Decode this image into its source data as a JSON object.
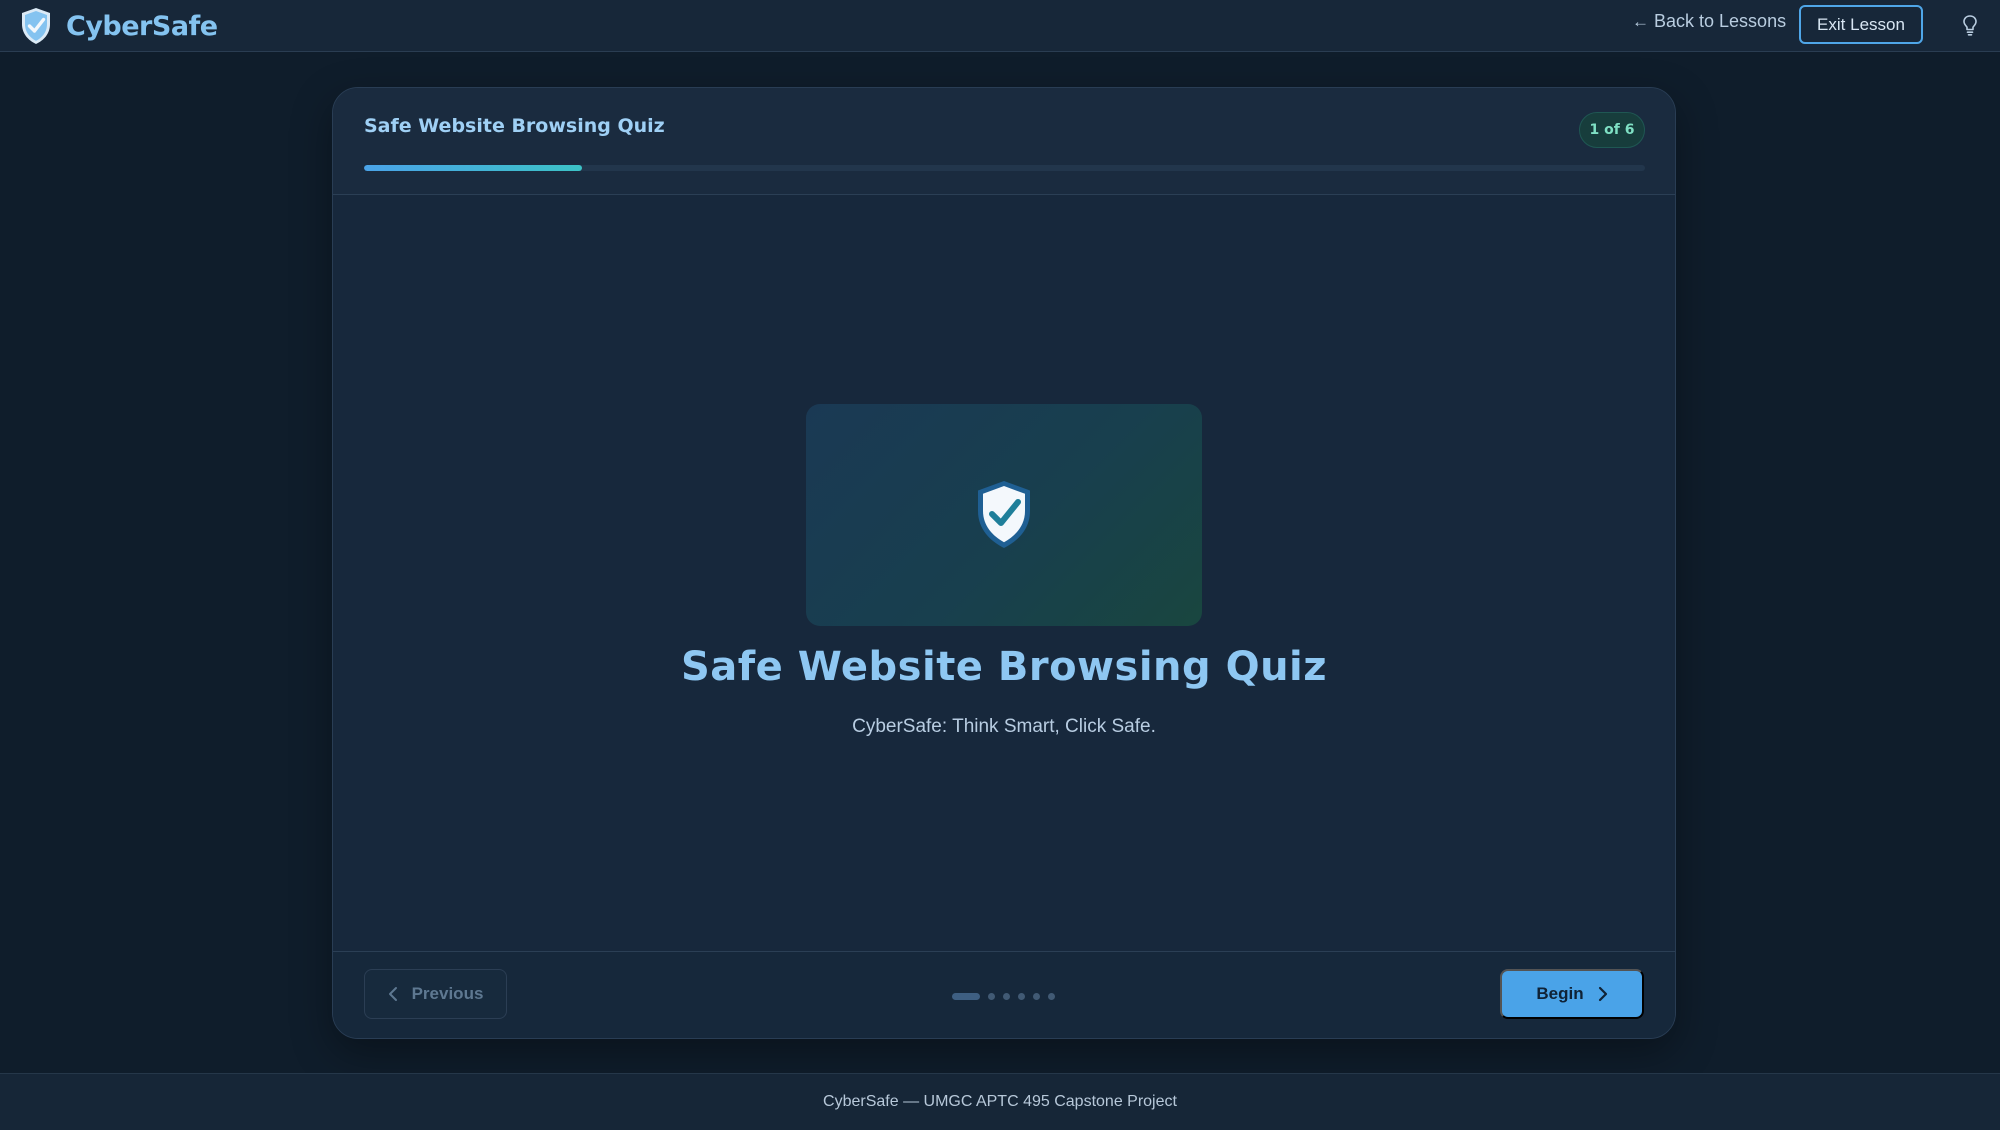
{
  "header": {
    "brand_name": "CyberSafe",
    "back_label": "Back to Lessons",
    "exit_label": "Exit Lesson",
    "icons": {
      "brand": "shield-check-icon",
      "back": "arrow-left-icon",
      "help": "lightbulb-icon"
    }
  },
  "lesson": {
    "title": "Safe Website Browsing Quiz",
    "step_label": "1 of 6",
    "progress_fraction": 0.17
  },
  "slide": {
    "icon": "shield-check-icon",
    "title": "Safe Website Browsing Quiz",
    "subtitle": "CyberSafe: Think Smart, Click Safe."
  },
  "nav": {
    "previous_label": "Previous",
    "begin_label": "Begin",
    "total_slides": 6,
    "current_slide": 1
  },
  "footer": {
    "text": "CyberSafe — UMGC APTC 495 Capstone Project"
  },
  "colors": {
    "accent": "#4aa3e8",
    "brand_text": "#84c3f0",
    "badge_text": "#7fe0c4"
  }
}
